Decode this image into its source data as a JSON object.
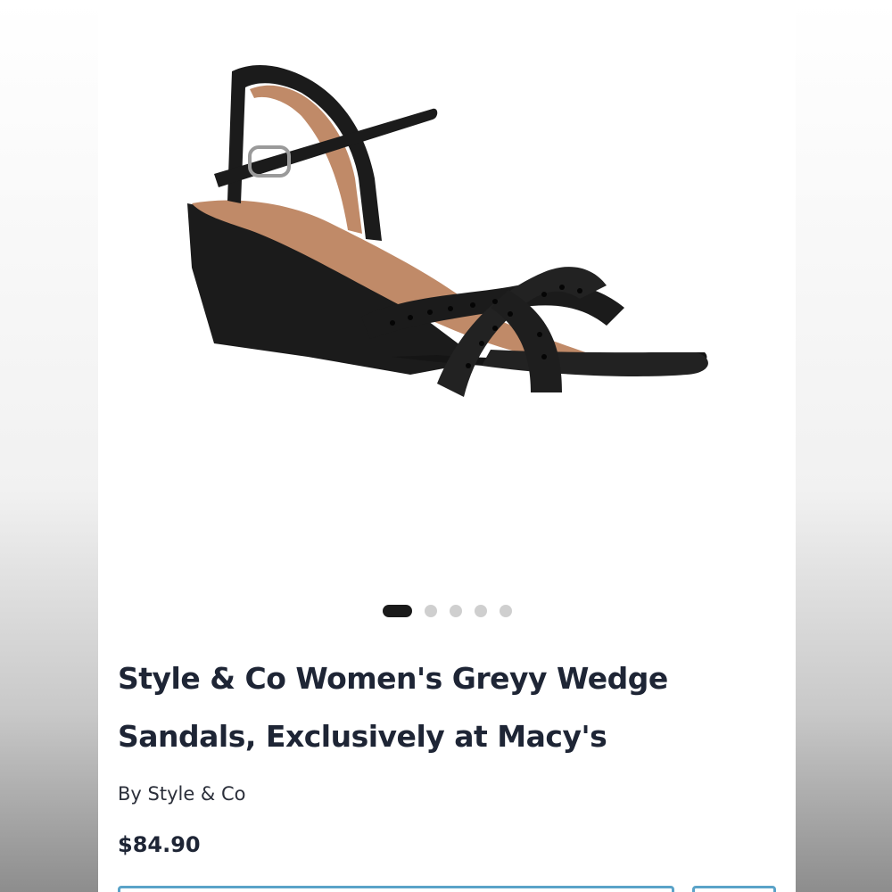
{
  "product": {
    "image_alt": "Black wedge sandal with studded cross straps",
    "title_line1": "Style & Co Women's Greyy Wedge",
    "title_line2": "Sandals, Exclusively at Macy's",
    "brand_line": "By Style & Co",
    "price": "$84.90"
  },
  "carousel": {
    "total": 5,
    "active_index": 0
  },
  "colors": {
    "title": "#1e2535",
    "active_dot": "#1a1a1a",
    "inactive_dot": "#cfcfcf",
    "button_border": "#5aa3c8",
    "sandal_body": "#1b1b1b",
    "sandal_lining": "#c08a68"
  }
}
